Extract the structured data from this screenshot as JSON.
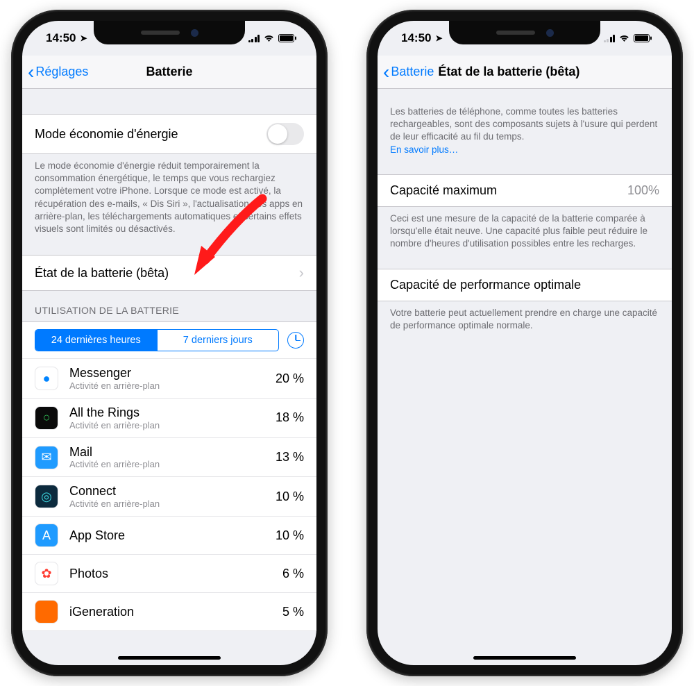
{
  "left": {
    "status": {
      "time": "14:50"
    },
    "nav": {
      "back": "Réglages",
      "title": "Batterie"
    },
    "low_power": {
      "label": "Mode économie d'énergie"
    },
    "low_power_footer": "Le mode économie d'énergie réduit temporairement la consommation énergétique, le temps que vous rechargiez complètement votre iPhone. Lorsque ce mode est activé, la récupération des e-mails, « Dis Siri », l'actualisation des apps en arrière-plan, les téléchargements automatiques et certains effets visuels sont limités ou désactivés.",
    "battery_health": {
      "label": "État de la batterie (bêta)"
    },
    "usage_header": "UTILISATION DE LA BATTERIE",
    "segments": {
      "day": "24 dernières heures",
      "week": "7 derniers jours"
    },
    "apps": [
      {
        "name": "Messenger",
        "sub": "Activité en arrière-plan",
        "pct": "20 %",
        "bg": "#fff",
        "fg": "#0084ff",
        "glyph": "●"
      },
      {
        "name": "All the Rings",
        "sub": "Activité en arrière-plan",
        "pct": "18 %",
        "bg": "#0a0a0a",
        "fg": "#34c759",
        "glyph": "○"
      },
      {
        "name": "Mail",
        "sub": "Activité en arrière-plan",
        "pct": "13 %",
        "bg": "#1f9bff",
        "fg": "#fff",
        "glyph": "✉"
      },
      {
        "name": "Connect",
        "sub": "Activité en arrière-plan",
        "pct": "10 %",
        "bg": "#0c2a3d",
        "fg": "#3dd6e0",
        "glyph": "◎"
      },
      {
        "name": "App Store",
        "sub": "",
        "pct": "10 %",
        "bg": "#1f9bff",
        "fg": "#fff",
        "glyph": "A"
      },
      {
        "name": "Photos",
        "sub": "",
        "pct": "6 %",
        "bg": "#fff",
        "fg": "#ff3b30",
        "glyph": "✿"
      },
      {
        "name": "iGeneration",
        "sub": "",
        "pct": "5 %",
        "bg": "#ff6a00",
        "fg": "#fff",
        "glyph": " "
      }
    ]
  },
  "right": {
    "status": {
      "time": "14:50"
    },
    "nav": {
      "back": "Batterie",
      "title": "État de la batterie (bêta)"
    },
    "intro": "Les batteries de téléphone, comme toutes les batteries rechargeables, sont des composants sujets à l'usure qui perdent de leur efficacité au fil du temps.",
    "intro_link": "En savoir plus…",
    "max_cap": {
      "label": "Capacité maximum",
      "value": "100%"
    },
    "max_cap_footer": "Ceci est une mesure de la capacité de la batterie comparée à lorsqu'elle était neuve. Une capacité plus faible peut réduire le nombre d'heures d'utilisation possibles entre les recharges.",
    "perf": {
      "label": "Capacité de performance optimale"
    },
    "perf_footer": "Votre batterie peut actuellement prendre en charge une capacité de performance optimale normale."
  }
}
